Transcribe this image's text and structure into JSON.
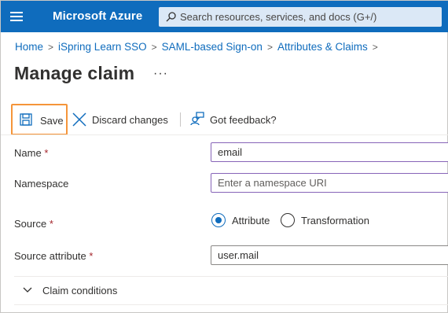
{
  "header": {
    "brand": "Microsoft Azure",
    "search_placeholder": "Search resources, services, and docs (G+/)",
    "bg_color": "#0f6cbd"
  },
  "breadcrumb": [
    "Home",
    "iSpring Learn SSO",
    "SAML-based Sign-on",
    "Attributes & Claims"
  ],
  "page": {
    "title": "Manage claim",
    "more": "···"
  },
  "toolbar": {
    "save_label": "Save",
    "discard_label": "Discard changes",
    "feedback_label": "Got feedback?",
    "save_highlight_color": "#f5953a"
  },
  "form": {
    "name": {
      "label": "Name",
      "required": "*",
      "value": "email"
    },
    "namespace": {
      "label": "Namespace",
      "placeholder": "Enter a namespace URI",
      "value": ""
    },
    "source": {
      "label": "Source",
      "required": "*",
      "options": [
        {
          "label": "Attribute",
          "selected": true
        },
        {
          "label": "Transformation",
          "selected": false
        }
      ]
    },
    "source_attribute": {
      "label": "Source attribute",
      "required": "*",
      "value": "user.mail"
    }
  },
  "claim_conditions": {
    "label": "Claim conditions",
    "expanded": false
  }
}
